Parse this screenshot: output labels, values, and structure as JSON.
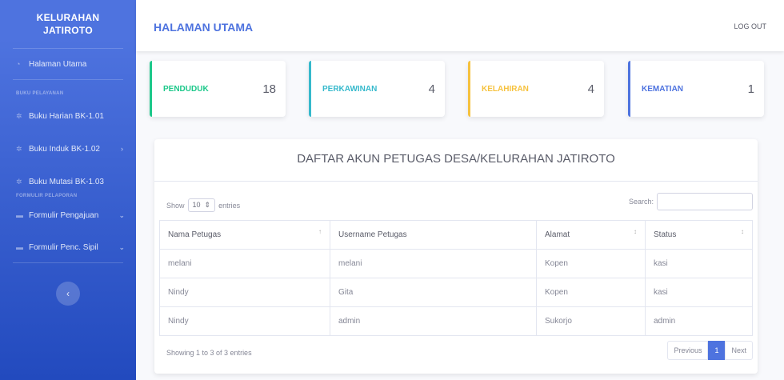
{
  "sidebar": {
    "brand_line1": "KELURAHAN",
    "brand_line2": "JATIROTO",
    "home": "Halaman Utama",
    "heading_buku": "BUKU PELAYANAN",
    "items_buku": [
      "Buku Harian BK-1.01",
      "Buku Induk BK-1.02",
      "Buku Mutasi BK-1.03"
    ],
    "heading_formulir": "FORMULIR PELAPORAN",
    "items_formulir": [
      "Formulir Pengajuan",
      "Formulir Penc. Sipil"
    ],
    "toggle_icon": "chevron-left-icon"
  },
  "topbar": {
    "title": "HALAMAN UTAMA",
    "logout": "LOG OUT"
  },
  "cards": [
    {
      "label": "PENDUDUK",
      "value": "18",
      "color": "#1cc88a"
    },
    {
      "label": "PERKAWINAN",
      "value": "4",
      "color": "#36b9cc"
    },
    {
      "label": "KELAHIRAN",
      "value": "4",
      "color": "#f6c23e"
    },
    {
      "label": "KEMATIAN",
      "value": "1",
      "color": "#4e73df"
    }
  ],
  "panel": {
    "title": "DAFTAR AKUN PETUGAS DESA/KELURAHAN JATIROTO",
    "show_prefix": "Show",
    "entries_value": "10",
    "entries_suffix": "entries",
    "search_label": "Search:",
    "columns": [
      "Nama Petugas",
      "Username Petugas",
      "Alamat",
      "Status"
    ],
    "rows": [
      [
        "melani",
        "melani",
        "Kopen",
        "kasi"
      ],
      [
        "Nindy",
        "Gita",
        "Kopen",
        "kasi"
      ],
      [
        "Nindy",
        "admin",
        "Sukorjo",
        "admin"
      ]
    ],
    "info": "Showing 1 to 3 of 3 entries",
    "pager": {
      "previous": "Previous",
      "current": "1",
      "next": "Next"
    }
  }
}
